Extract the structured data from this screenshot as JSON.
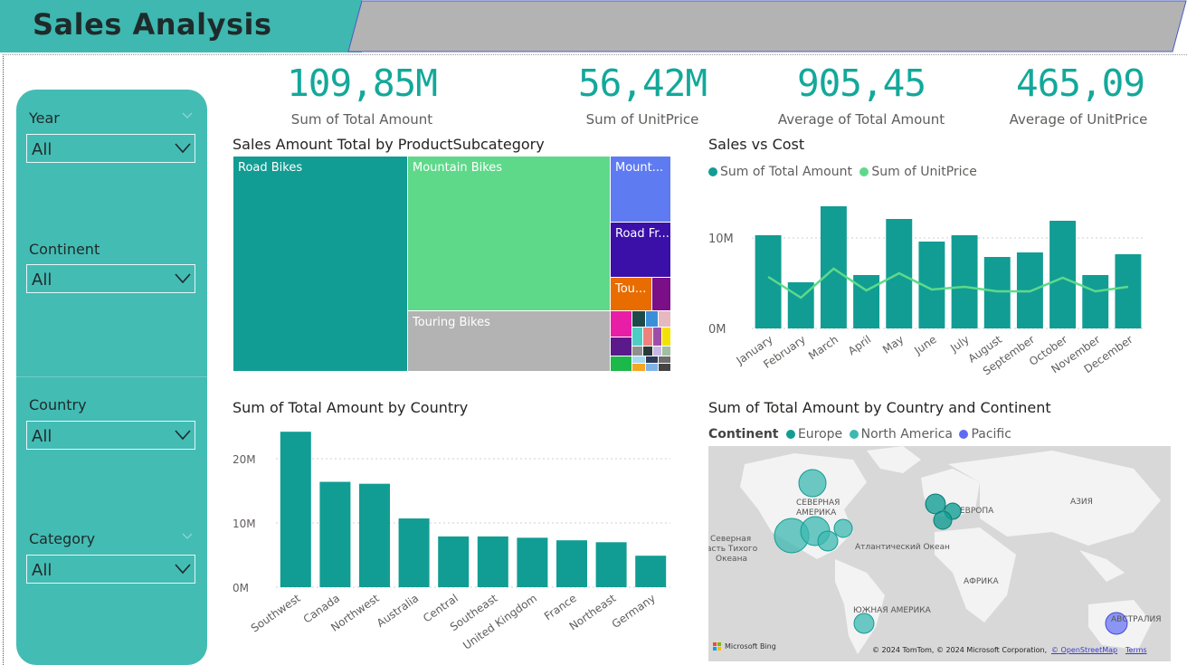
{
  "header": {
    "title": "Sales  Analysis"
  },
  "slicers": [
    {
      "label": "Year",
      "value": "All",
      "top_chevron": true
    },
    {
      "label": "Continent",
      "value": "All",
      "top_chevron": false
    },
    {
      "label": "Country",
      "value": "All",
      "top_chevron": false
    },
    {
      "label": "Category",
      "value": "All",
      "top_chevron": true
    }
  ],
  "kpis": [
    {
      "value": "109,85M",
      "label": "Sum of Total Amount"
    },
    {
      "value": "56,42M",
      "label": "Sum of UnitPrice"
    },
    {
      "value": "905,45",
      "label": "Average of Total Amount"
    },
    {
      "value": "465,09",
      "label": "Average of UnitPrice"
    }
  ],
  "colors": {
    "teal": "#43bcb4",
    "accent": "#13a89a",
    "bar": "#119d93",
    "line": "#5ed98a"
  },
  "treemap": {
    "title": "Sales Amount Total by ProductSubcategory",
    "items": [
      {
        "label": "Road Bikes",
        "color": "#119d93"
      },
      {
        "label": "Mountain Bikes",
        "color": "#5ed98a"
      },
      {
        "label": "Touring Bikes",
        "color": "#b3b3b3"
      },
      {
        "label": "Mount...",
        "color": "#5f7bf2"
      },
      {
        "label": "Road Fr...",
        "color": "#3a10a8"
      },
      {
        "label": "Tou...",
        "color": "#e86c00"
      }
    ]
  },
  "chart_data": [
    {
      "type": "bar+line",
      "title": "Sales vs Cost",
      "categories": [
        "January",
        "February",
        "March",
        "April",
        "May",
        "June",
        "July",
        "August",
        "September",
        "October",
        "November",
        "December"
      ],
      "series": [
        {
          "name": "Sum of Total Amount",
          "type": "bar",
          "color": "#119d93",
          "values": [
            10.3,
            5.1,
            13.5,
            5.9,
            12.1,
            9.6,
            10.3,
            7.9,
            8.4,
            11.9,
            5.9,
            8.2
          ]
        },
        {
          "name": "Sum of UnitPrice",
          "type": "line",
          "color": "#5ed98a",
          "values": [
            5.7,
            3.4,
            6.6,
            4.2,
            6.1,
            4.3,
            4.6,
            4.1,
            4.1,
            5.6,
            4.1,
            4.6
          ]
        }
      ],
      "y_ticks": [
        "0M",
        "10M"
      ],
      "ylim": [
        0,
        15
      ]
    },
    {
      "type": "bar",
      "title": "Sum of Total Amount by Country",
      "categories": [
        "Southwest",
        "Canada",
        "Northwest",
        "Australia",
        "Central",
        "Southeast",
        "United Kingdom",
        "France",
        "Northeast",
        "Germany"
      ],
      "values": [
        24.2,
        16.4,
        16.1,
        10.7,
        7.9,
        7.9,
        7.7,
        7.3,
        7.0,
        4.9
      ],
      "y_ticks": [
        "0M",
        "10M",
        "20M"
      ],
      "ylim": [
        0,
        25
      ]
    }
  ],
  "map": {
    "title": "Sum of Total Amount by Country and Continent",
    "legend_title": "Continent",
    "legend": [
      {
        "name": "Europe",
        "color": "#119d93"
      },
      {
        "name": "North America",
        "color": "#3eb8b0"
      },
      {
        "name": "Pacific",
        "color": "#5f6cf2"
      }
    ],
    "labels": {
      "na1": "СЕВЕРНАЯ",
      "na2": "АМЕРИКА",
      "europe": "ЕВРОПА",
      "asia": "АЗИЯ",
      "ocean1": "Северная",
      "ocean2": "асть Тихого",
      "ocean3": "Океана",
      "atlantic": "Атлантический Океан",
      "africa": "АФРИКА",
      "sa": "ЮЖНАЯ АМЕРИКА",
      "aus": "АВСТРАЛИЯ"
    },
    "bing": "Microsoft Bing",
    "copyright": "© 2024 TomTom, © 2024 Microsoft Corporation,",
    "osm": "© OpenStreetMap",
    "terms": "Terms"
  }
}
